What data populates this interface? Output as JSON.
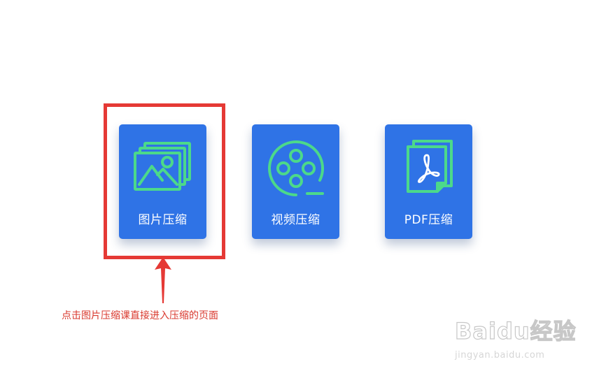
{
  "cards": [
    {
      "id": "image",
      "label": "图片压缩",
      "icon": "image-stack-icon"
    },
    {
      "id": "video",
      "label": "视频压缩",
      "icon": "film-reel-icon"
    },
    {
      "id": "pdf",
      "label": "PDF压缩",
      "icon": "pdf-document-icon"
    }
  ],
  "annotation": {
    "caption": "点击图片压缩课直接进入压缩的页面",
    "box_color": "#e53935",
    "arrow_color": "#e53935",
    "text_color": "#d93a2f"
  },
  "watermark": {
    "brand": "Baidu经验",
    "url": "jingyan.baidu.com"
  },
  "colors": {
    "card_bg": "#2f73e6",
    "icon_accent": "#4cd98a",
    "card_text": "#ffffff"
  }
}
